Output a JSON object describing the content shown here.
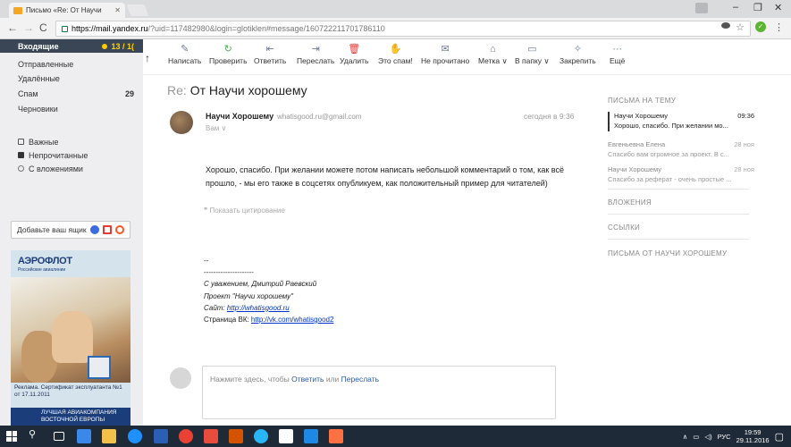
{
  "browser": {
    "tab_title": "Письмо «Re: От Научи",
    "url_host": "https://mail.yandex.ru",
    "url_path": "/?uid=117482980&login=glotiklen#message/160722211701786110"
  },
  "sidebar": {
    "folders": [
      {
        "label": "Входящие",
        "count": "13 / 1("
      },
      {
        "label": "Отправленные",
        "count": ""
      },
      {
        "label": "Удалённые",
        "count": ""
      },
      {
        "label": "Спам",
        "count": "29"
      },
      {
        "label": "Черновики",
        "count": ""
      }
    ],
    "labels": [
      {
        "label": "Важные",
        "icon": "important-icon"
      },
      {
        "label": "Непрочитанные",
        "icon": "unread-icon"
      },
      {
        "label": "С вложениями",
        "icon": "attachment-icon"
      }
    ],
    "add_mailbox": "Добавьте ваш ящик",
    "ad": {
      "logo": "АЭРОФЛОТ",
      "logo_sub": "Российские авиалинии",
      "caption": "Реклама. Сертификат эксплуатанта №1 от 17.11.2011",
      "bottom": "ЛУЧШАЯ АВИАКОМПАНИЯ ВОСТОЧНОЙ ЕВРОПЫ"
    }
  },
  "toolbar": {
    "items": [
      {
        "label": "Написать",
        "icon": "compose-icon"
      },
      {
        "label": "Проверить",
        "icon": "refresh-icon"
      },
      {
        "label": "Ответить",
        "icon": "reply-icon"
      },
      {
        "label": "Переслать",
        "icon": "forward-icon"
      },
      {
        "label": "Удалить",
        "icon": "delete-icon"
      },
      {
        "label": "Это спам!",
        "icon": "spam-icon"
      },
      {
        "label": "Не прочитано",
        "icon": "unread-envelope-icon"
      },
      {
        "label": "Метка ∨",
        "icon": "tag-icon"
      },
      {
        "label": "В папку ∨",
        "icon": "folder-icon"
      },
      {
        "label": "Закрепить",
        "icon": "pin-icon"
      },
      {
        "label": "Ещё",
        "icon": "more-icon"
      }
    ]
  },
  "message": {
    "subject_prefix": "Re:",
    "subject": "От Научи хорошему",
    "sender_name": "Научи Хорошему",
    "sender_email": "whatisgood.ru@gmail.com",
    "to": "Вам ∨",
    "date": "сегодня в 9:36",
    "body": "Хорошо, спасибо. При желании можете потом написать небольшой комментарий о том, как всё прошло, - мы его также в соцсетях опубликуем, как положительный пример для читателей)",
    "show_quote": "Показать цитирование",
    "signature": {
      "dash": "--",
      "line": "---------------------",
      "regards": "С уважением, Дмитрий Раевский",
      "project": "Проект \"Научи хорошему\"",
      "site_label": "Сайт: ",
      "site_link": "http://whatisgood.ru",
      "vk_label": "Страница ВК: ",
      "vk_link": "http://vk.com/whatisgood2"
    }
  },
  "reply": {
    "prefix": "Нажмите здесь, чтобы ",
    "reply_action": "Ответить",
    "or": " или ",
    "forward_action": "Переслать"
  },
  "right_panel": {
    "thread_title": "ПИСЬМА НА ТЕМУ",
    "threads": [
      {
        "from": "Научи Хорошему",
        "date": "09:36",
        "snippet": "Хорошо, спасибо. При желании мо..."
      },
      {
        "from": "Евгеньевна Елена",
        "date": "28 ноя",
        "snippet": "Спасибо вам огромное за проект. В с..."
      },
      {
        "from": "Научи Хорошему",
        "date": "28 ноя",
        "snippet": "Спасибо за реферат - очень простые ..."
      }
    ],
    "attachments": "ВЛОЖЕНИЯ",
    "links": "ССЫЛКИ",
    "from_sender": "ПИСЬМА ОТ НАУЧИ ХОРОШЕМУ"
  },
  "taskbar": {
    "lang": "РУС",
    "time": "19:59",
    "date": "29.11.2016"
  }
}
